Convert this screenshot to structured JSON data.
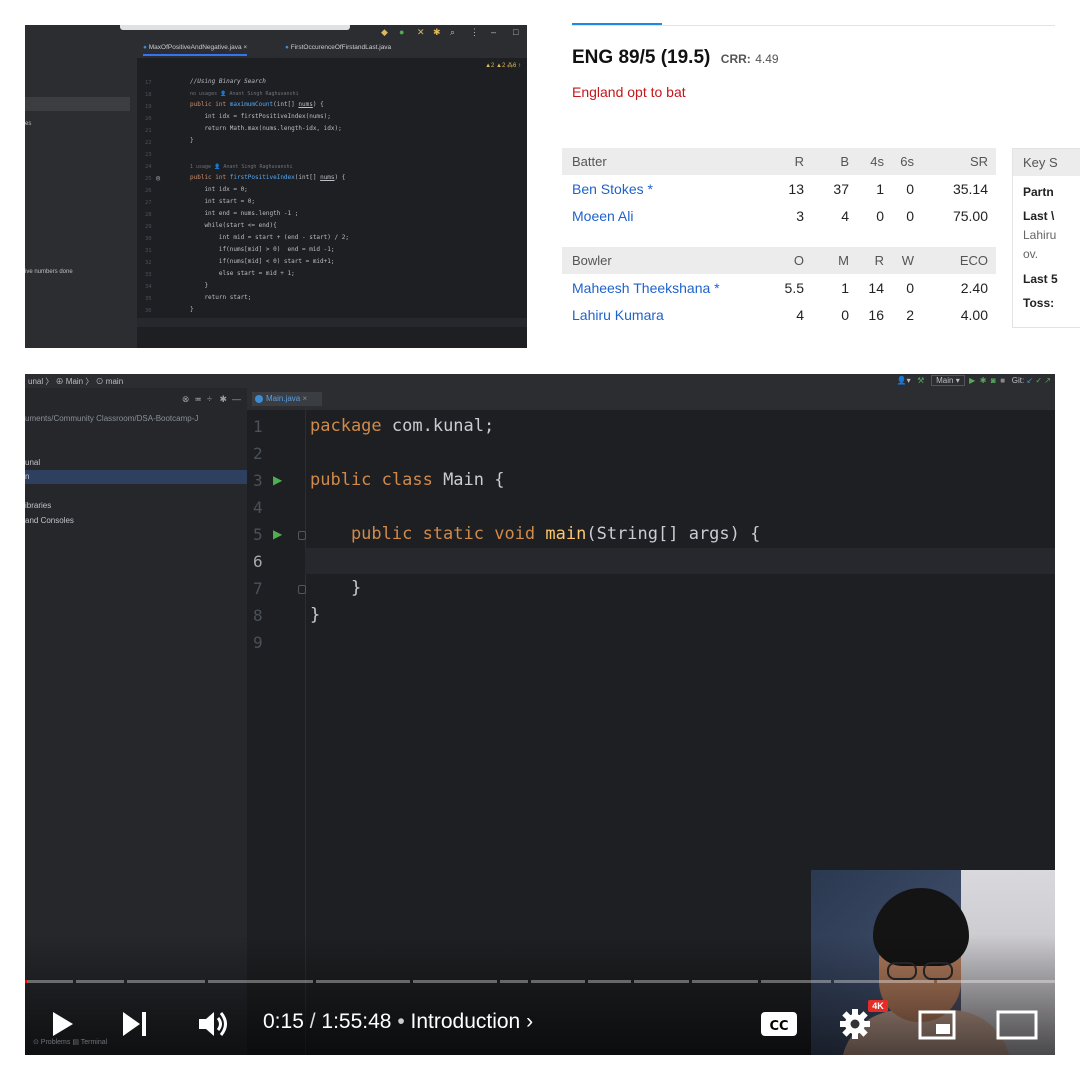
{
  "ide_small": {
    "tab_active": "MaxOfPositiveAndNegative.java",
    "tab_other": "FirstOccurenceOfFirstandLast.java",
    "warnings": "▲2 ▲2 ⁂6 ↑",
    "sidebar_snippet_1": "es",
    "sidebar_snippet_2": "ive numbers done",
    "hint_no_usages": "no usages  👤 Anant Singh Raghuvanshi",
    "hint_one_usage": "1 usage  👤 Anant Singh Raghuvanshi",
    "lines": [
      "17",
      "18",
      "19",
      "20",
      "21",
      "22",
      "23",
      "24",
      "25",
      "26",
      "27",
      "28",
      "29",
      "30",
      "31",
      "32",
      "33",
      "34",
      "35",
      "36",
      "37"
    ],
    "code": {
      "c1": "//Using Binary Search",
      "c2a": "public int ",
      "c2b": "maximumCount",
      "c2c": "(int[] ",
      "c2d": "nums",
      "c2e": ") {",
      "c3": "    int idx = firstPositiveIndex(nums);",
      "c4": "    return Math.max(nums.length-idx, idx);",
      "c5": "}",
      "c6a": "public int ",
      "c6b": "firstPositiveIndex",
      "c6c": "(int[] ",
      "c6d": "nums",
      "c6e": ") {",
      "c7": "    int idx = 0;",
      "c8": "    int start = 0;",
      "c9": "    int end = nums.length -1 ;",
      "c10": "    while(start <= end){",
      "c11": "        int mid = start + (end - start) / 2;",
      "c12": "        if(nums[mid] > 0)  end = mid -1;",
      "c13": "        if(nums[mid] < 0) start = mid+1;",
      "c14": "        else start = mid + 1;",
      "c15": "    }",
      "c16": "    return start;",
      "c17": "}"
    }
  },
  "scorecard": {
    "score": "ENG 89/5 (19.5)",
    "crr_label": "CRR:",
    "crr_value": "4.49",
    "status": "England opt to bat",
    "batter_headers": [
      "Batter",
      "R",
      "B",
      "4s",
      "6s",
      "SR"
    ],
    "batters": [
      {
        "name": "Ben Stokes *",
        "r": "13",
        "b": "37",
        "fours": "1",
        "sixes": "0",
        "sr": "35.14"
      },
      {
        "name": "Moeen Ali",
        "r": "3",
        "b": "4",
        "fours": "0",
        "sixes": "0",
        "sr": "75.00"
      }
    ],
    "bowler_headers": [
      "Bowler",
      "O",
      "M",
      "R",
      "W",
      "ECO"
    ],
    "bowlers": [
      {
        "name": "Maheesh Theekshana *",
        "o": "5.5",
        "m": "1",
        "r": "14",
        "w": "0",
        "eco": "2.40"
      },
      {
        "name": "Lahiru Kumara",
        "o": "4",
        "m": "0",
        "r": "16",
        "w": "2",
        "eco": "4.00"
      }
    ],
    "key_stats": {
      "header": "Key S",
      "partnership": "Partn",
      "last_wkt": "Last \\",
      "last_wkt_detail": "Lahiru",
      "last_wkt_ov": "ov.",
      "last5": "Last 5",
      "toss": "Toss:"
    }
  },
  "video": {
    "breadcrumb": "unal 〉 ⊕ Main 〉 ⊙ main",
    "run_config": "Main ▾",
    "git_label": "Git:",
    "project_path": "uments/Community Classroom/DSA-Bootcamp-J",
    "project_items": [
      "unal",
      "n",
      "ibraries",
      "and Consoles"
    ],
    "editor_tab": "Main.java",
    "line_numbers": [
      "1",
      "2",
      "3",
      "4",
      "5",
      "6",
      "7",
      "8",
      "9"
    ],
    "code": {
      "l1a": "package",
      "l1b": " com.kunal;",
      "l3a": "public class",
      "l3b": " Main {",
      "l5a": "    public static void ",
      "l5b": "main",
      "l5c": "(String[] args) {",
      "l7": "    }",
      "l8": "}"
    },
    "status_bottom": "⊙ Problems    ▤ Terminal",
    "time_current": "0:15",
    "time_total": "1:55:48",
    "chapter": "Introduction",
    "quality_badge": "4K",
    "played_fraction": 0.0022
  }
}
